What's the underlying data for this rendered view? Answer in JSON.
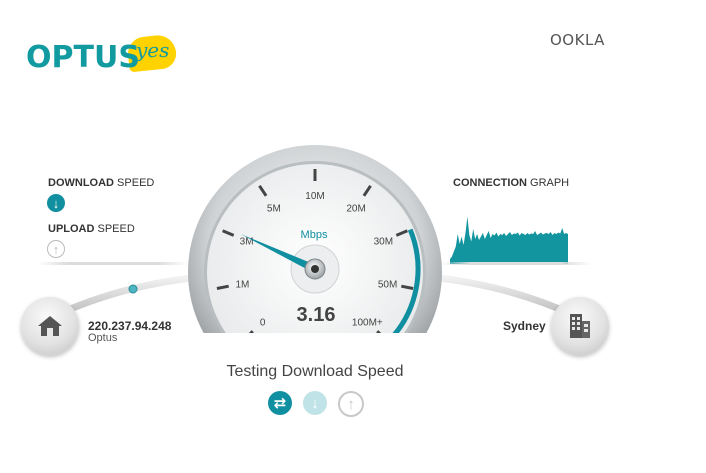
{
  "brand": {
    "optus_text": "OPTUS",
    "yes_text": "yes",
    "ookla_text": "OOKLA",
    "teal": "#119aa0",
    "yellow": "#ffd200"
  },
  "left_panel": {
    "download_bold": "DOWNLOAD",
    "download_rest": " SPEED",
    "upload_bold": "UPLOAD",
    "upload_rest": " SPEED",
    "download_icon": "arrow-down-icon",
    "upload_icon": "arrow-up-icon"
  },
  "right_panel": {
    "connection_bold": "CONNECTION",
    "connection_rest": " GRAPH"
  },
  "gauge": {
    "unit": "Mbps",
    "value": "3.16",
    "ticks": [
      "0",
      "1M",
      "3M",
      "5M",
      "10M",
      "20M",
      "30M",
      "50M",
      "100M+"
    ],
    "needle_tick_position": 2.08,
    "accent": "#0f8fa0"
  },
  "graph": {
    "color": "#13959f",
    "samples": [
      0.1,
      0.15,
      0.25,
      0.35,
      0.6,
      0.4,
      0.55,
      0.38,
      0.62,
      0.95,
      0.58,
      0.45,
      0.7,
      0.5,
      0.6,
      0.48,
      0.55,
      0.62,
      0.5,
      0.58,
      0.66,
      0.52,
      0.6,
      0.57,
      0.63,
      0.55,
      0.6,
      0.58,
      0.62,
      0.56,
      0.6,
      0.64,
      0.58,
      0.61,
      0.6,
      0.63,
      0.57,
      0.62,
      0.6,
      0.58,
      0.62,
      0.59,
      0.61,
      0.6,
      0.66,
      0.58,
      0.6,
      0.63,
      0.59,
      0.61,
      0.62,
      0.6,
      0.64,
      0.58,
      0.62,
      0.6,
      0.63,
      0.61,
      0.72,
      0.6,
      0.62,
      0.6
    ]
  },
  "client": {
    "ip": "220.237.94.248",
    "isp": "Optus",
    "icon": "home-icon"
  },
  "server": {
    "city": "Sydney",
    "icon": "building-icon"
  },
  "status": "Testing Download Speed",
  "steps": {
    "ping_icon": "ping-arrows-icon",
    "download_icon": "arrow-down-icon",
    "upload_icon": "arrow-up-icon"
  }
}
